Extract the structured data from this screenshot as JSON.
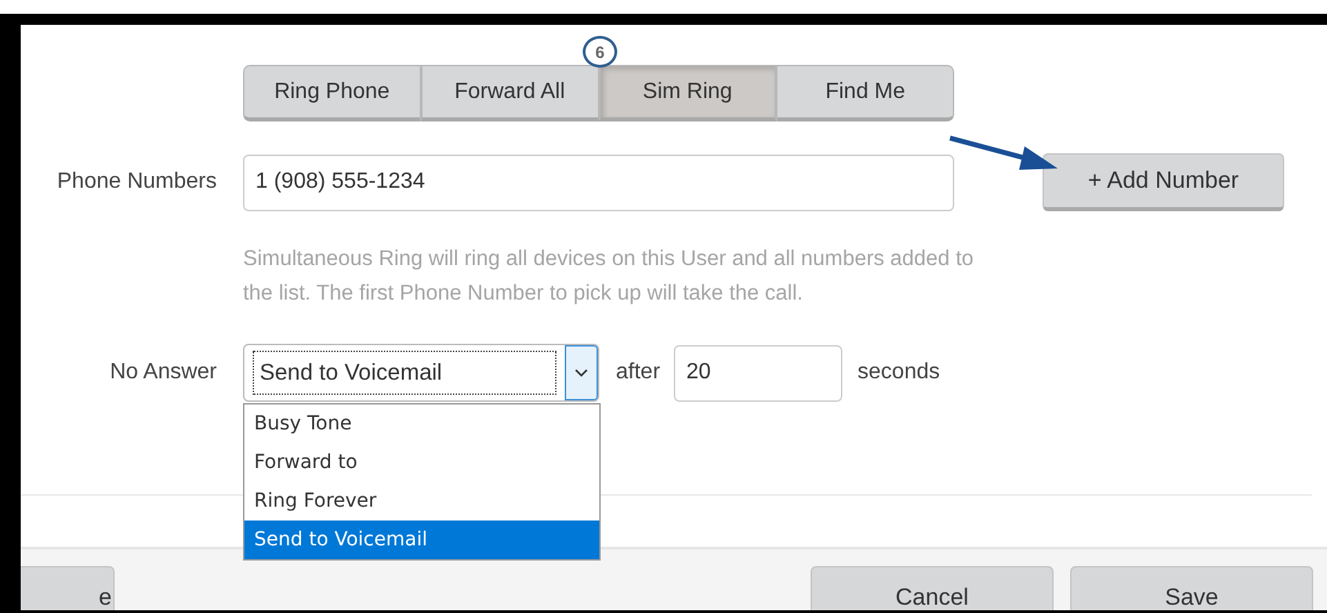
{
  "step_badge": "6",
  "tabs": [
    {
      "label": "Ring Phone",
      "selected": false
    },
    {
      "label": "Forward All",
      "selected": false
    },
    {
      "label": "Sim Ring",
      "selected": true
    },
    {
      "label": "Find Me",
      "selected": false
    }
  ],
  "phone_numbers": {
    "label": "Phone Numbers",
    "value": "1 (908) 555-1234",
    "add_button": "+ Add Number"
  },
  "help_text": "Simultaneous Ring will ring all devices on this User and all numbers added to the list. The first Phone Number to pick up will take the call.",
  "no_answer": {
    "label": "No Answer",
    "value": "Send to Voicemail",
    "expanded": true,
    "after_label": "after",
    "seconds_value": "20",
    "seconds_label": "seconds",
    "options": [
      {
        "label": "Busy Tone",
        "selected": false
      },
      {
        "label": "Forward to",
        "selected": false
      },
      {
        "label": "Ring Forever",
        "selected": false
      },
      {
        "label": "Send to Voicemail",
        "selected": true
      }
    ]
  },
  "footer_buttons": [
    "e",
    "Cancel",
    "Save"
  ]
}
